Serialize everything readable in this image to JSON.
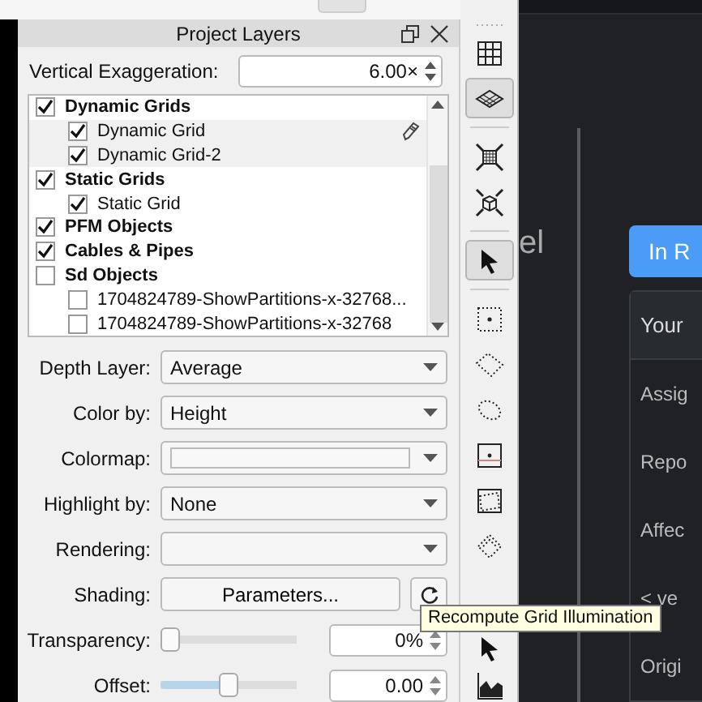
{
  "panel": {
    "title": "Project Layers",
    "exaggeration": {
      "label": "Vertical Exaggeration:",
      "value": "6.00×"
    },
    "layers": [
      {
        "label": "Dynamic Grids",
        "checked": true,
        "selected": false,
        "edit_icon": false,
        "children": [
          {
            "label": "Dynamic Grid",
            "checked": true,
            "selected": true,
            "edit_icon": true
          },
          {
            "label": "Dynamic Grid-2",
            "checked": true,
            "selected": true,
            "edit_icon": false
          }
        ]
      },
      {
        "label": "Static Grids",
        "checked": true,
        "selected": false,
        "edit_icon": false,
        "children": [
          {
            "label": "Static Grid",
            "checked": true,
            "selected": false,
            "edit_icon": false
          }
        ]
      },
      {
        "label": "PFM Objects",
        "checked": true,
        "selected": false,
        "edit_icon": false
      },
      {
        "label": "Cables & Pipes",
        "checked": true,
        "selected": false,
        "edit_icon": false
      },
      {
        "label": "Sd Objects",
        "checked": false,
        "selected": false,
        "edit_icon": false,
        "children": [
          {
            "label": "1704824789-ShowPartitions-x-32768...",
            "checked": false,
            "selected": false,
            "edit_icon": false
          },
          {
            "label": "1704824789-ShowPartitions-x-32768",
            "checked": false,
            "selected": false,
            "edit_icon": false
          }
        ]
      }
    ],
    "properties": [
      {
        "kind": "select",
        "label": "Depth Layer:",
        "value": "Average"
      },
      {
        "kind": "select",
        "label": "Color by:",
        "value": "Height"
      },
      {
        "kind": "colormap",
        "label": "Colormap:"
      },
      {
        "kind": "select",
        "label": "Highlight by:",
        "value": "None"
      },
      {
        "kind": "select",
        "label": "Rendering:"
      },
      {
        "kind": "button",
        "label": "Shading:",
        "value": "Parameters..."
      },
      {
        "kind": "slider",
        "label": "Transparency:",
        "level": 0.0,
        "value": "0%"
      },
      {
        "kind": "slider",
        "label": "Offset:",
        "level": 0.5,
        "value": "0.00"
      }
    ]
  },
  "tooltip": "Recompute Grid Illumination",
  "toolbar": [
    {
      "kind": "grid",
      "selected": false
    },
    {
      "kind": "layers",
      "selected": true
    },
    {
      "kind": "sep"
    },
    {
      "kind": "cube-grid",
      "selected": false
    },
    {
      "kind": "cube",
      "selected": false
    },
    {
      "kind": "sep"
    },
    {
      "kind": "pointer",
      "selected": true
    },
    {
      "kind": "sep"
    },
    {
      "kind": "dot-rect",
      "selected": false
    },
    {
      "kind": "dot-diamond",
      "selected": false
    },
    {
      "kind": "dot-ellipse",
      "selected": false
    },
    {
      "kind": "frame",
      "selected": false
    },
    {
      "kind": "skew",
      "selected": false
    },
    {
      "kind": "small-diamond",
      "selected": false
    },
    {
      "kind": "pointer",
      "selected": false
    },
    {
      "kind": "chart",
      "selected": false
    }
  ],
  "background": {
    "fragment": "el",
    "button": "In R",
    "card_header": "Your",
    "rows": [
      "Assig",
      "Repo",
      "Affec",
      "< ve",
      "Origi"
    ]
  }
}
